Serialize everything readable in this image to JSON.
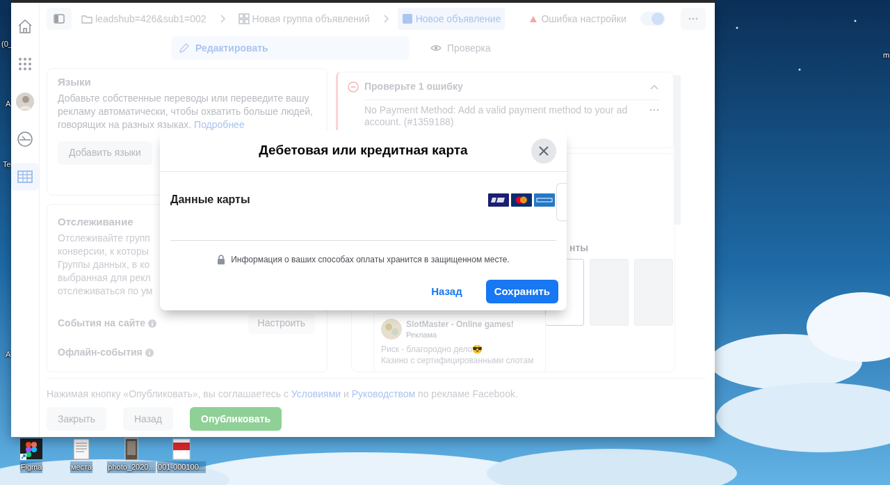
{
  "desktop": {
    "edge_labels": [
      {
        "text": "(0_"
      },
      {
        "text": "A"
      },
      {
        "text": "Te"
      },
      {
        "text": "A"
      },
      {
        "text": "m"
      }
    ],
    "icons": [
      {
        "label": "Figma",
        "kind": "figma"
      },
      {
        "label": "места",
        "kind": "document"
      },
      {
        "label": "photo_2020..."
      },
      {
        "label": "001-000100...",
        "kind": "pdf"
      }
    ]
  },
  "rail": {
    "items": [
      {
        "kind": "home",
        "selected": false
      },
      {
        "kind": "apps",
        "selected": false
      },
      {
        "kind": "avatar",
        "selected": false
      },
      {
        "kind": "gauge",
        "selected": false
      },
      {
        "kind": "table",
        "selected": true
      }
    ]
  },
  "top_bar": {
    "breadcrumbs": [
      {
        "kind": "folder",
        "label": "leadshub=426&sub1=002",
        "selected": false
      },
      {
        "kind": "group",
        "label": "Новая группа объявлений",
        "selected": false
      },
      {
        "kind": "ad",
        "label": "Новое объявление",
        "selected": true
      }
    ],
    "status": "Ошибка настройки",
    "toggle_on": true
  },
  "tabs": [
    {
      "kind": "edit",
      "label": "Редактировать",
      "selected": true
    },
    {
      "kind": "preview",
      "label": "Проверка",
      "selected": false
    }
  ],
  "languages_card": {
    "title": "Языки",
    "description": "Добавьте собственные переводы или переведите вашу рекламу автоматически, чтобы охватить больше людей, говорящих на разных языках.",
    "link": "Подробнее",
    "button": "Добавить языки"
  },
  "tracking_card": {
    "title": "Отслеживание",
    "description_lines": [
      "Отслеживайте групп",
      "конверсии, к которы",
      "Группы данных, в ко",
      "выбранная для рекл",
      "отслеживаться по ум"
    ],
    "rows": [
      {
        "label": "События на сайте",
        "button": "Настроить"
      },
      {
        "label": "Офлайн-события"
      }
    ]
  },
  "errors_card": {
    "title": "Проверьте 1 ошибку",
    "expanded": true,
    "message_lines": [
      "No Payment Method: Add a valid payment method to your ad",
      "account. (#1359188)"
    ]
  },
  "placements": {
    "label": "нты",
    "options": [
      {
        "selected": true
      },
      {
        "selected": false
      },
      {
        "selected": false
      }
    ]
  },
  "ad_preview": {
    "page_name": "SlotMaster - Online games!",
    "sponsored": "Реклама",
    "text_lines": [
      "Риск - благородно дело😎",
      "Казино с сертифицированными слотам"
    ]
  },
  "footer": {
    "notice": [
      {
        "text": "Нажимая кнопку «Опубликовать», вы соглашаетесь с ",
        "link": false
      },
      {
        "text": "Условиями",
        "link": true
      },
      {
        "text": " и ",
        "link": false
      },
      {
        "text": "Руководством",
        "link": true
      },
      {
        "text": " по рекламе Facebook.",
        "link": false
      }
    ],
    "buttons": [
      {
        "label": "Закрыть",
        "kind": "secondary"
      },
      {
        "label": "Назад",
        "kind": "secondary"
      },
      {
        "label": "Опубликовать",
        "kind": "primary"
      }
    ]
  },
  "modal": {
    "title": "Дебетовая или кредитная карта",
    "section_label": "Данные карты",
    "card_brands": [
      {
        "kind": "visa"
      },
      {
        "kind": "mastercard"
      },
      {
        "kind": "amex"
      }
    ],
    "security_note": "Информация о ваших способах оплаты хранится в защищенном месте.",
    "buttons": [
      {
        "label": "Назад",
        "kind": "link"
      },
      {
        "label": "Сохранить",
        "kind": "primary"
      }
    ]
  }
}
